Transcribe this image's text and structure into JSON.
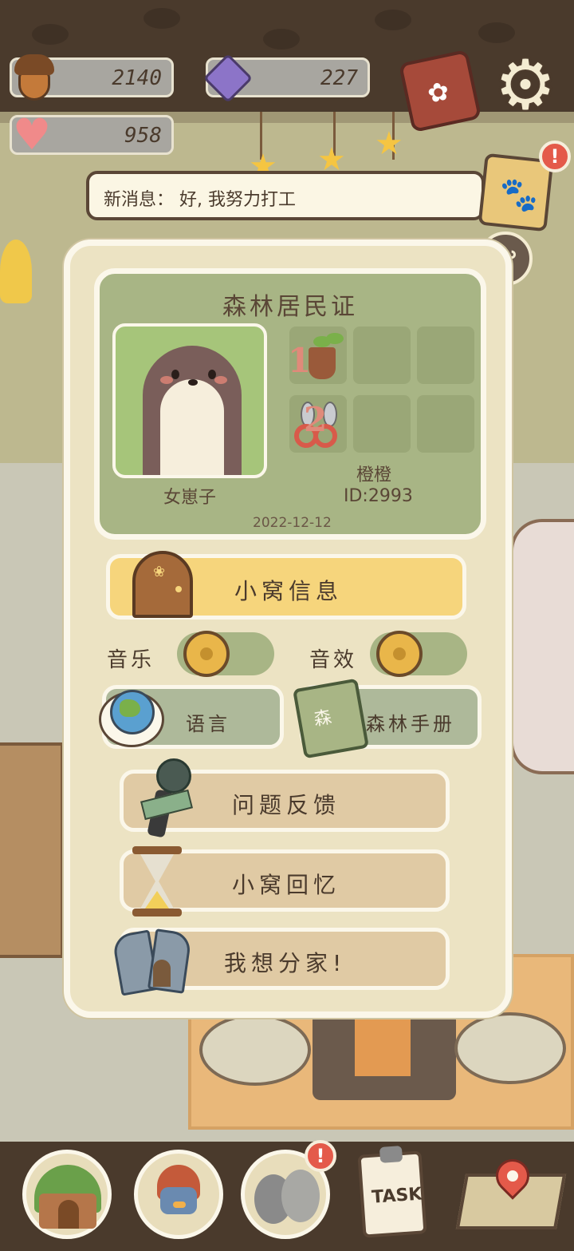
{
  "resources": {
    "acorns": "2140",
    "gems": "227",
    "hearts": "958"
  },
  "message_bar": {
    "text": "新消息： 好, 我努力打工"
  },
  "alerts": {
    "mark": "!"
  },
  "id_card": {
    "title": "森林居民证",
    "nickname": "女崽子",
    "owner_name": "橙橙",
    "id_text": "ID:2993",
    "date": "2022-12-12",
    "badges": [
      "1",
      "2"
    ]
  },
  "menu": {
    "nest_info": "小窝信息",
    "music_label": "音乐",
    "sfx_label": "音效",
    "music_on": false,
    "sfx_on": false,
    "language": "语言",
    "forest_manual": "森林手册",
    "manual_cover": "森",
    "feedback": "问题反馈",
    "nest_memories": "小窝回忆",
    "move_out": "我想分家!"
  },
  "bottom_nav": {
    "task_label": "TASK"
  },
  "colors": {
    "panel_bg": "#ece3c3",
    "card_green": "#a8b585",
    "highlight_yellow": "#f6d57c",
    "button_tan": "#e0caa4",
    "alert_red": "#e45a4a",
    "dark_brown": "#4a3a2c"
  },
  "icons": {
    "resources": [
      "acorn-icon",
      "gem-icon",
      "heart-icon"
    ],
    "top_right": [
      "book-icon",
      "gear-icon"
    ],
    "menu": [
      "door-icon",
      "globe-icon",
      "manual-book-icon",
      "microphone-icon",
      "hourglass-icon",
      "broken-house-icon"
    ],
    "nav": [
      "house-icon",
      "penguin-icon",
      "eggs-icon",
      "task-clipboard-icon",
      "map-icon"
    ]
  }
}
